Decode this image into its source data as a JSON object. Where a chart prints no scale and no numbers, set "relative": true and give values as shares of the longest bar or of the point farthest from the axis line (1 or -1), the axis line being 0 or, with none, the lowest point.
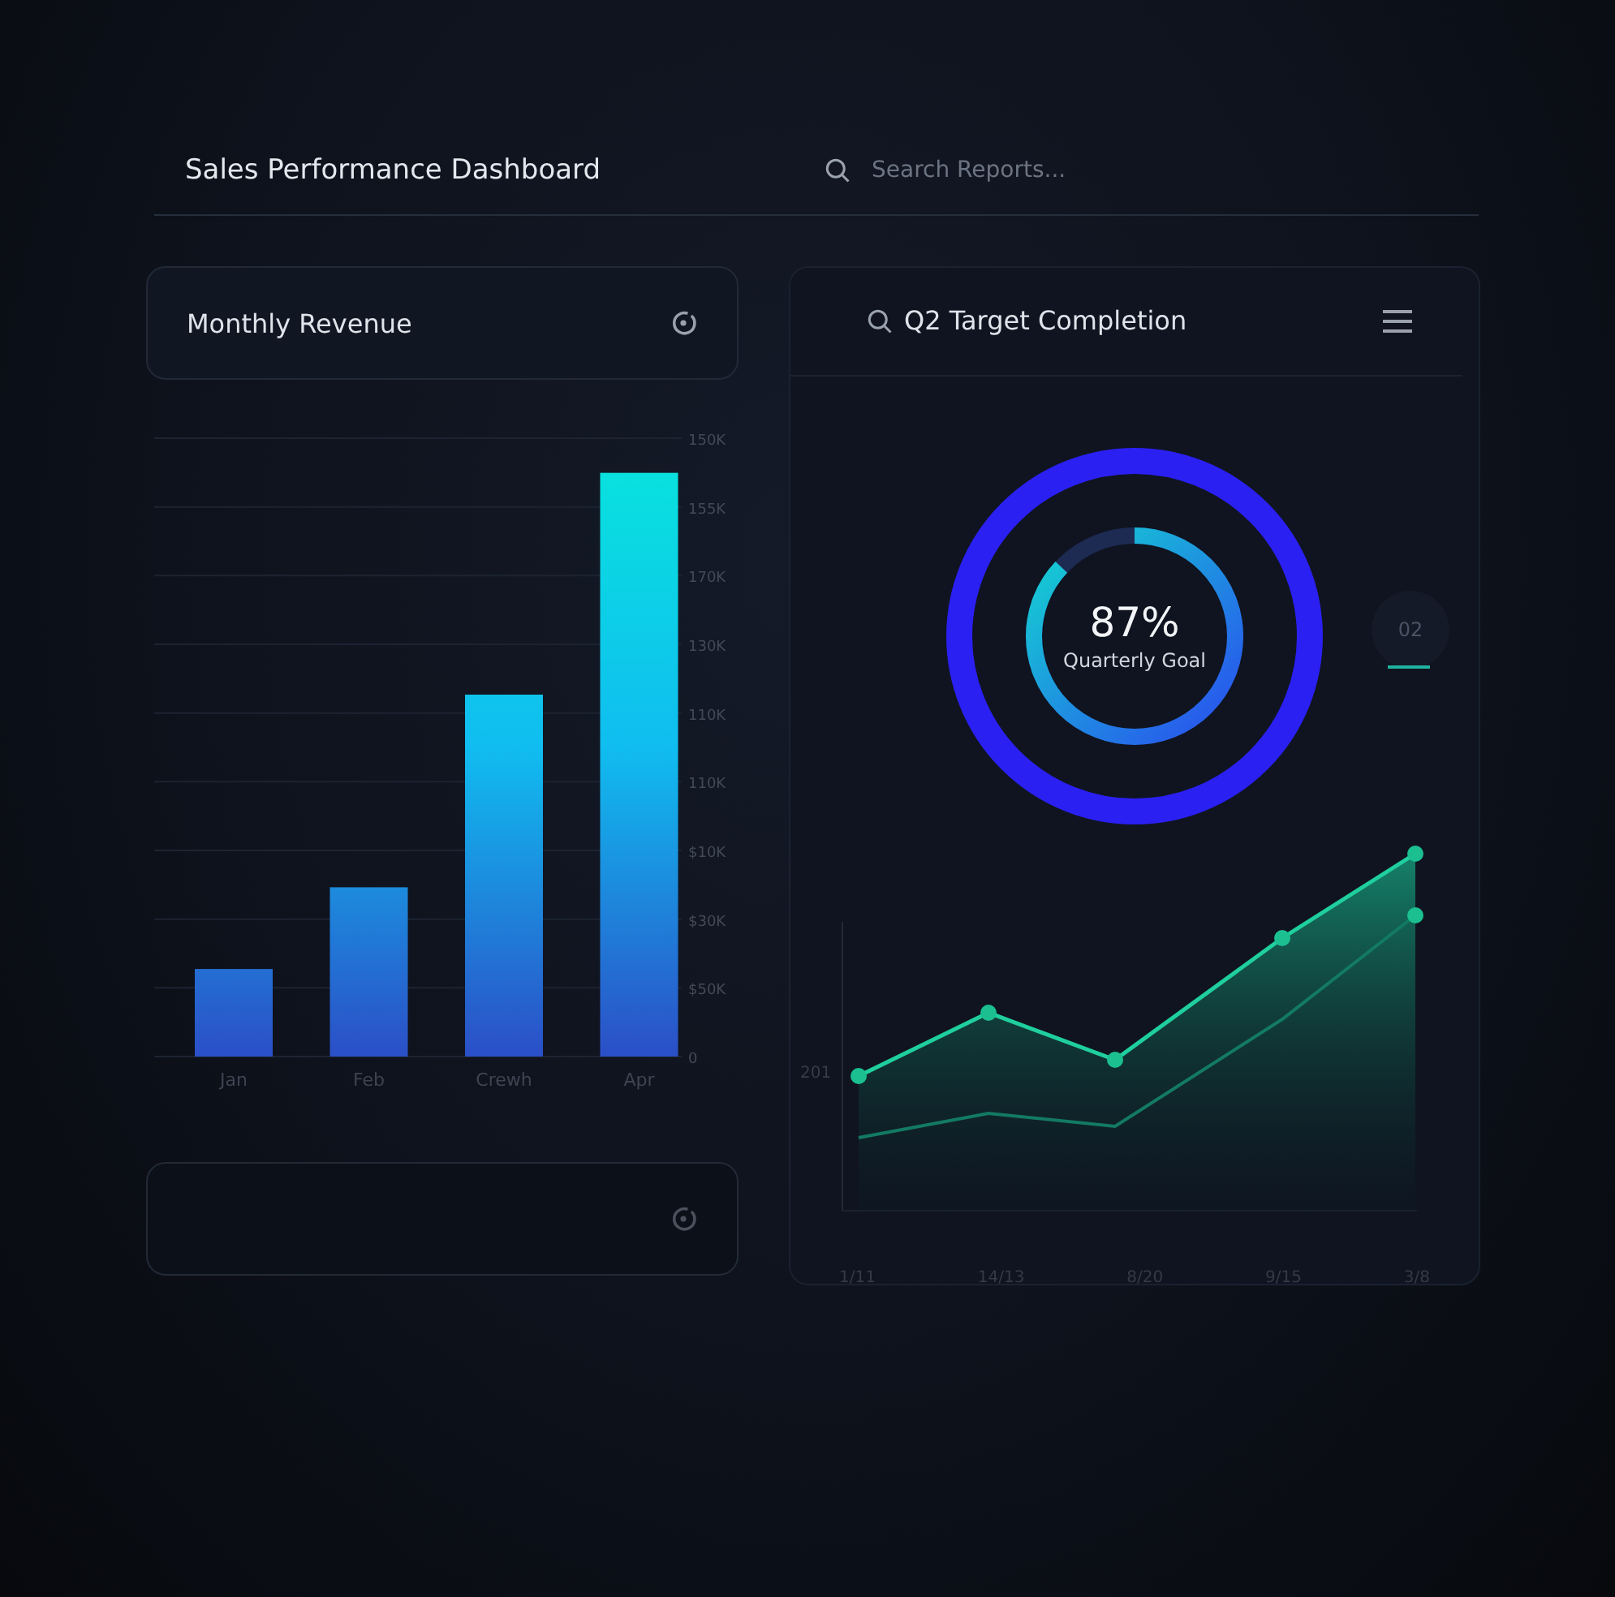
{
  "header": {
    "title": "Sales Performance Dashboard",
    "search": {
      "placeholder": "Search Reports..."
    }
  },
  "revenue": {
    "title": "Monthly Revenue",
    "y_axis_labels": [
      "150K",
      "155K",
      "170K",
      "130K",
      "110K",
      "110K",
      "$10K",
      "$30K",
      "$50K",
      "0"
    ],
    "chart_data": {
      "type": "bar",
      "relative": true,
      "categories": [
        "Jan",
        "Feb",
        "Crewh",
        "Apr"
      ],
      "values": [
        0.15,
        0.29,
        0.62,
        1
      ]
    }
  },
  "target": {
    "title": "Q2 Target Completion",
    "percent": "87%",
    "caption": "Quarterly Goal",
    "badge": "02",
    "trend": {
      "y_label": "201",
      "x_labels": [
        "1/11",
        "14/13",
        "8/20",
        "9/15",
        "3/8"
      ]
    }
  }
}
